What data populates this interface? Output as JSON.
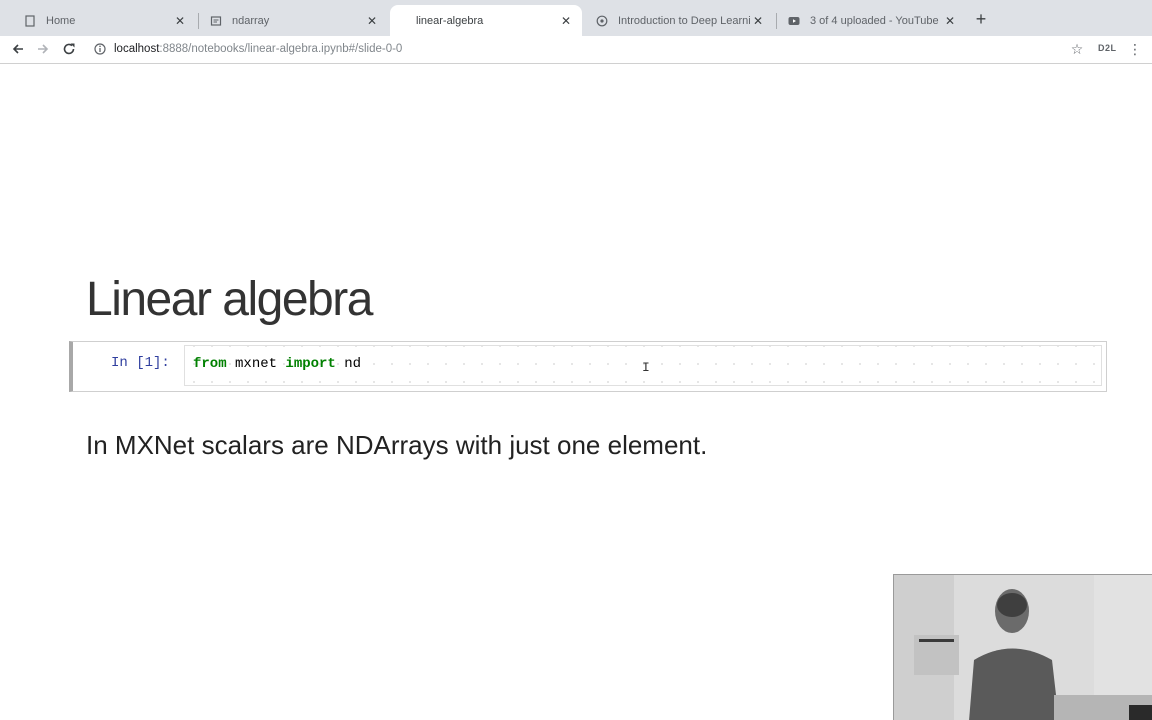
{
  "browser": {
    "tabs": [
      {
        "title": "Home",
        "icon": "jupyter-page-icon",
        "active": false
      },
      {
        "title": "ndarray",
        "icon": "notebook-page-icon",
        "active": false
      },
      {
        "title": "linear-algebra",
        "icon": "notebook-page-icon",
        "active": true
      },
      {
        "title": "Introduction to Deep Learning",
        "icon": "globe-icon",
        "active": false
      },
      {
        "title": "3 of 4 uploaded - YouTube",
        "icon": "youtube-icon",
        "active": false
      }
    ],
    "new_tab_label": "+",
    "address": {
      "host": "localhost",
      "path": ":8888/notebooks/linear-algebra.ipynb#/slide-0-0"
    },
    "extension_badge": "D2L"
  },
  "slide": {
    "title": "Linear algebra",
    "code_cell": {
      "prompt": "In [1]:",
      "tokens": [
        "from",
        " mxnet ",
        "import",
        " nd"
      ]
    },
    "text": "In MXNet scalars are NDArrays with just one element."
  },
  "colors": {
    "tabstrip_bg": "#dee1e6",
    "keyword": "#008000",
    "prompt": "#303f9f",
    "title_text": "#333333"
  }
}
